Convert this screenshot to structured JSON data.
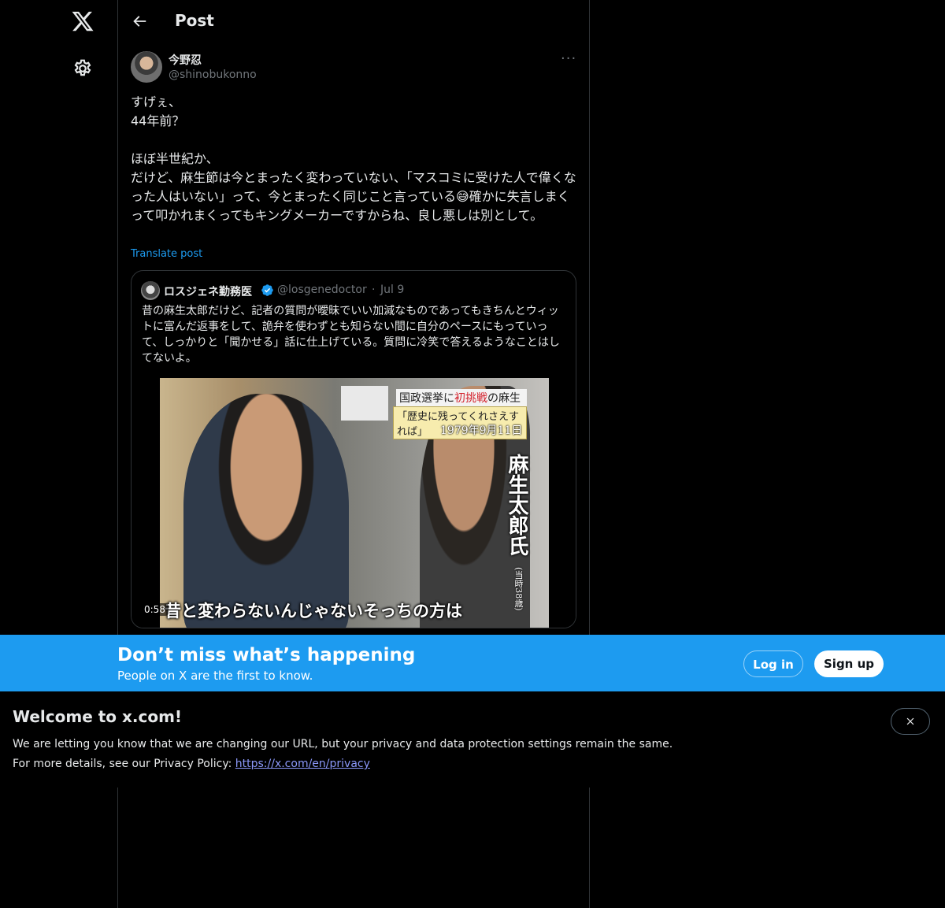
{
  "header": {
    "title": "Post"
  },
  "post": {
    "author_name": "今野忍",
    "author_handle": "@shinobukonno",
    "text": "すげぇ、\n44年前？\n\nほぼ半世紀か、\nだけど、麻生節は今とまったく変わっていない、「マスコミに受けた人で偉くなった人はいない」って、今とまったく同じこと言っている😅確かに失言しまくって叩かれまくってもキングメーカーですからね、良し悪しは別として。",
    "translate_label": "Translate post"
  },
  "quote": {
    "author_name": "ロスジェネ勤務医",
    "author_handle": "@losgenedoctor",
    "separator": "·",
    "date": "Jul 9",
    "text": "昔の麻生太郎だけど、記者の質問が曖昧でいい加減なものであってもきちんとウィットに富んだ返事をして、詭弁を使わずとも知らない間に自分のペースにもっていって、しっかりと「聞かせる」話に仕上げている。質問に冷笑で答えるようなことはしてないよ。",
    "video": {
      "duration": "0:58",
      "banner_pre": "国政選挙に",
      "banner_red": "初挑戦",
      "banner_post": "の麻生氏",
      "banner_quote": "「歴史に残ってくれさえすれば」",
      "banner_date": "1979年9月11日",
      "vertical_name": "麻生太郎氏",
      "vertical_age": "(当時38歳)",
      "subtitle": "昔と変わらないんじゃないそっちの方は"
    }
  },
  "cta": {
    "title": "Don’t miss what’s happening",
    "subtitle": "People on X are the first to know.",
    "login_label": "Log in",
    "signup_label": "Sign up"
  },
  "notice": {
    "title": "Welcome to x.com!",
    "line1": "We are letting you know that we are changing our URL, but your privacy and data protection settings remain the same.",
    "line2_prefix": "For more details, see our Privacy Policy: ",
    "link": "https://x.com/en/privacy"
  },
  "colors": {
    "accent": "#1d9bf0",
    "background": "#000000",
    "muted": "#71767b",
    "link": "#8b98f9"
  },
  "icons": {
    "logo": "x-logo-icon",
    "settings": "gear-icon",
    "back": "back-arrow-icon",
    "more": "more-icon",
    "verified": "verified-badge-icon",
    "close": "close-icon"
  }
}
